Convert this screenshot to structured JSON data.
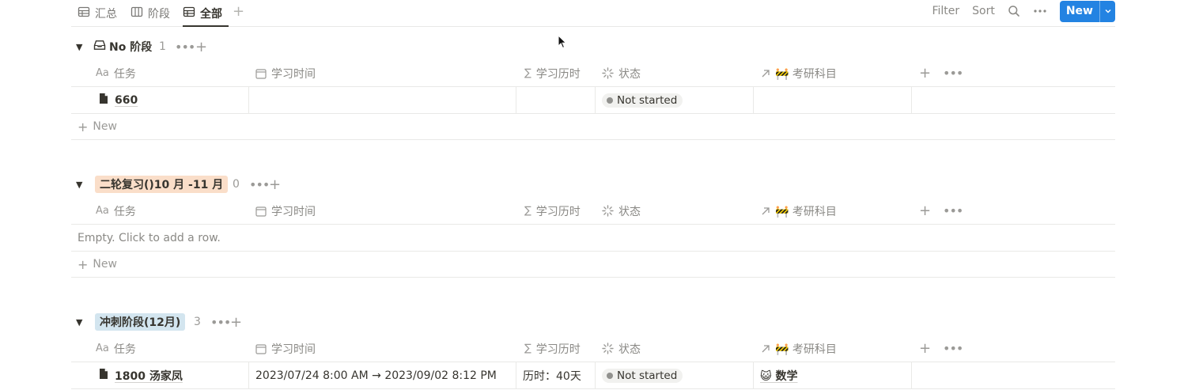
{
  "views": {
    "tabs": [
      {
        "label": "汇总",
        "icon": "table-icon"
      },
      {
        "label": "阶段",
        "icon": "board-icon"
      },
      {
        "label": "全部",
        "icon": "table-icon",
        "active": true
      }
    ],
    "add_view_label": "+"
  },
  "toolbar": {
    "filter_label": "Filter",
    "sort_label": "Sort",
    "search_icon": "search-icon",
    "more_icon": "more-icon",
    "new_label": "New",
    "accent_color": "#2383e2"
  },
  "columns": [
    {
      "icon": "Aa",
      "label": "任务"
    },
    {
      "icon": "calendar-icon",
      "label": "学习时间"
    },
    {
      "icon": "sum-icon",
      "label": "学习历时"
    },
    {
      "icon": "status-icon",
      "label": "状态"
    },
    {
      "icon": "relation-icon",
      "label": "🚧 考研科目"
    }
  ],
  "groups": [
    {
      "icon": "inbox-icon",
      "title": "No 阶段",
      "count": "1",
      "rows": [
        {
          "task": "660",
          "time": "",
          "duration": "",
          "status": "Not started",
          "subject": ""
        }
      ],
      "new_label": "New"
    },
    {
      "title": "二轮复习()10 月 -11 月",
      "pill_bg": "#fadec9",
      "count": "0",
      "empty_text": "Empty. Click to add a row.",
      "new_label": "New"
    },
    {
      "title": "冲刺阶段(12月)",
      "pill_bg": "#d3e5ef",
      "count": "3",
      "rows": [
        {
          "task": "1800 汤家凤",
          "time": "2023/07/24 8:00 AM → 2023/09/02 8:12 PM",
          "duration": "历时：40天",
          "status": "Not started",
          "subject": "😺 数学"
        }
      ]
    }
  ]
}
